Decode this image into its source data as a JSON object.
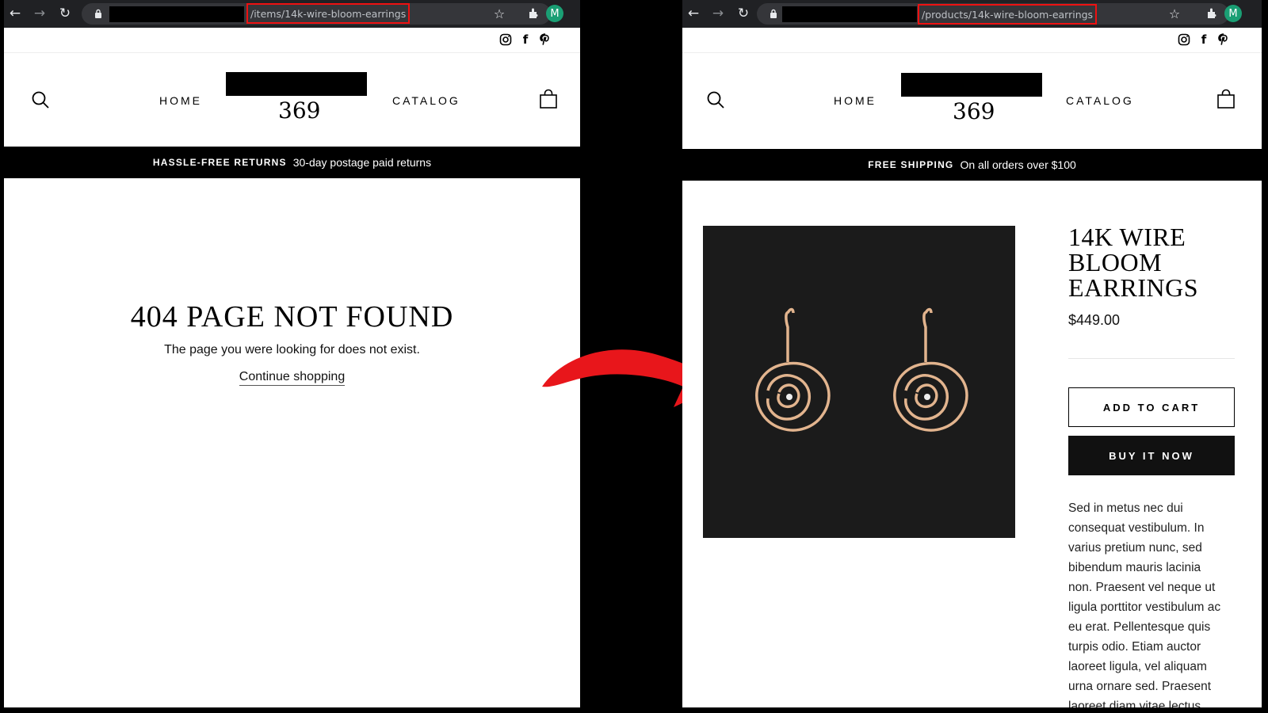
{
  "left": {
    "url_path": "/items/14k-wire-bloom-earrings",
    "profile_initial": "M",
    "nav": {
      "home": "HOME",
      "catalog": "CATALOG"
    },
    "logo_text": "369",
    "announcement": {
      "strong": "HASSLE-FREE RETURNS",
      "text": "30-day postage paid returns"
    },
    "not_found": {
      "title": "404 PAGE NOT FOUND",
      "subtitle": "The page you were looking for does not exist.",
      "link": "Continue shopping"
    }
  },
  "right": {
    "url_path": "/products/14k-wire-bloom-earrings",
    "profile_initial": "M",
    "nav": {
      "home": "HOME",
      "catalog": "CATALOG"
    },
    "logo_text": "369",
    "announcement": {
      "strong": "FREE SHIPPING",
      "text": "On all orders over $100"
    },
    "product": {
      "title_lines": [
        "14K WIRE",
        "BLOOM",
        "EARRINGS"
      ],
      "price": "$449.00",
      "add_to_cart": "ADD TO CART",
      "buy_now": "BUY IT NOW",
      "description_lines": [
        "Sed in metus nec dui",
        "consequat vestibulum. In",
        "varius pretium nunc, sed",
        "bibendum mauris lacinia",
        "non. Praesent vel neque ut",
        "ligula porttitor vestibulum ac",
        "eu erat. Pellentesque quis",
        "turpis odio. Etiam auctor",
        "laoreet ligula, vel aliquam",
        "urna ornare sed. Praesent",
        "laoreet diam vitae lectus"
      ]
    }
  },
  "colors": {
    "highlight": "#e11111",
    "arrow": "#e8161b",
    "chrome": "#202124",
    "announcement_bg": "#000000"
  },
  "icons": [
    "back-icon",
    "forward-icon",
    "reload-icon",
    "lock-icon",
    "star-icon",
    "extensions-icon",
    "instagram-icon",
    "facebook-icon",
    "pinterest-icon",
    "search-icon",
    "cart-icon",
    "arrow-icon"
  ]
}
